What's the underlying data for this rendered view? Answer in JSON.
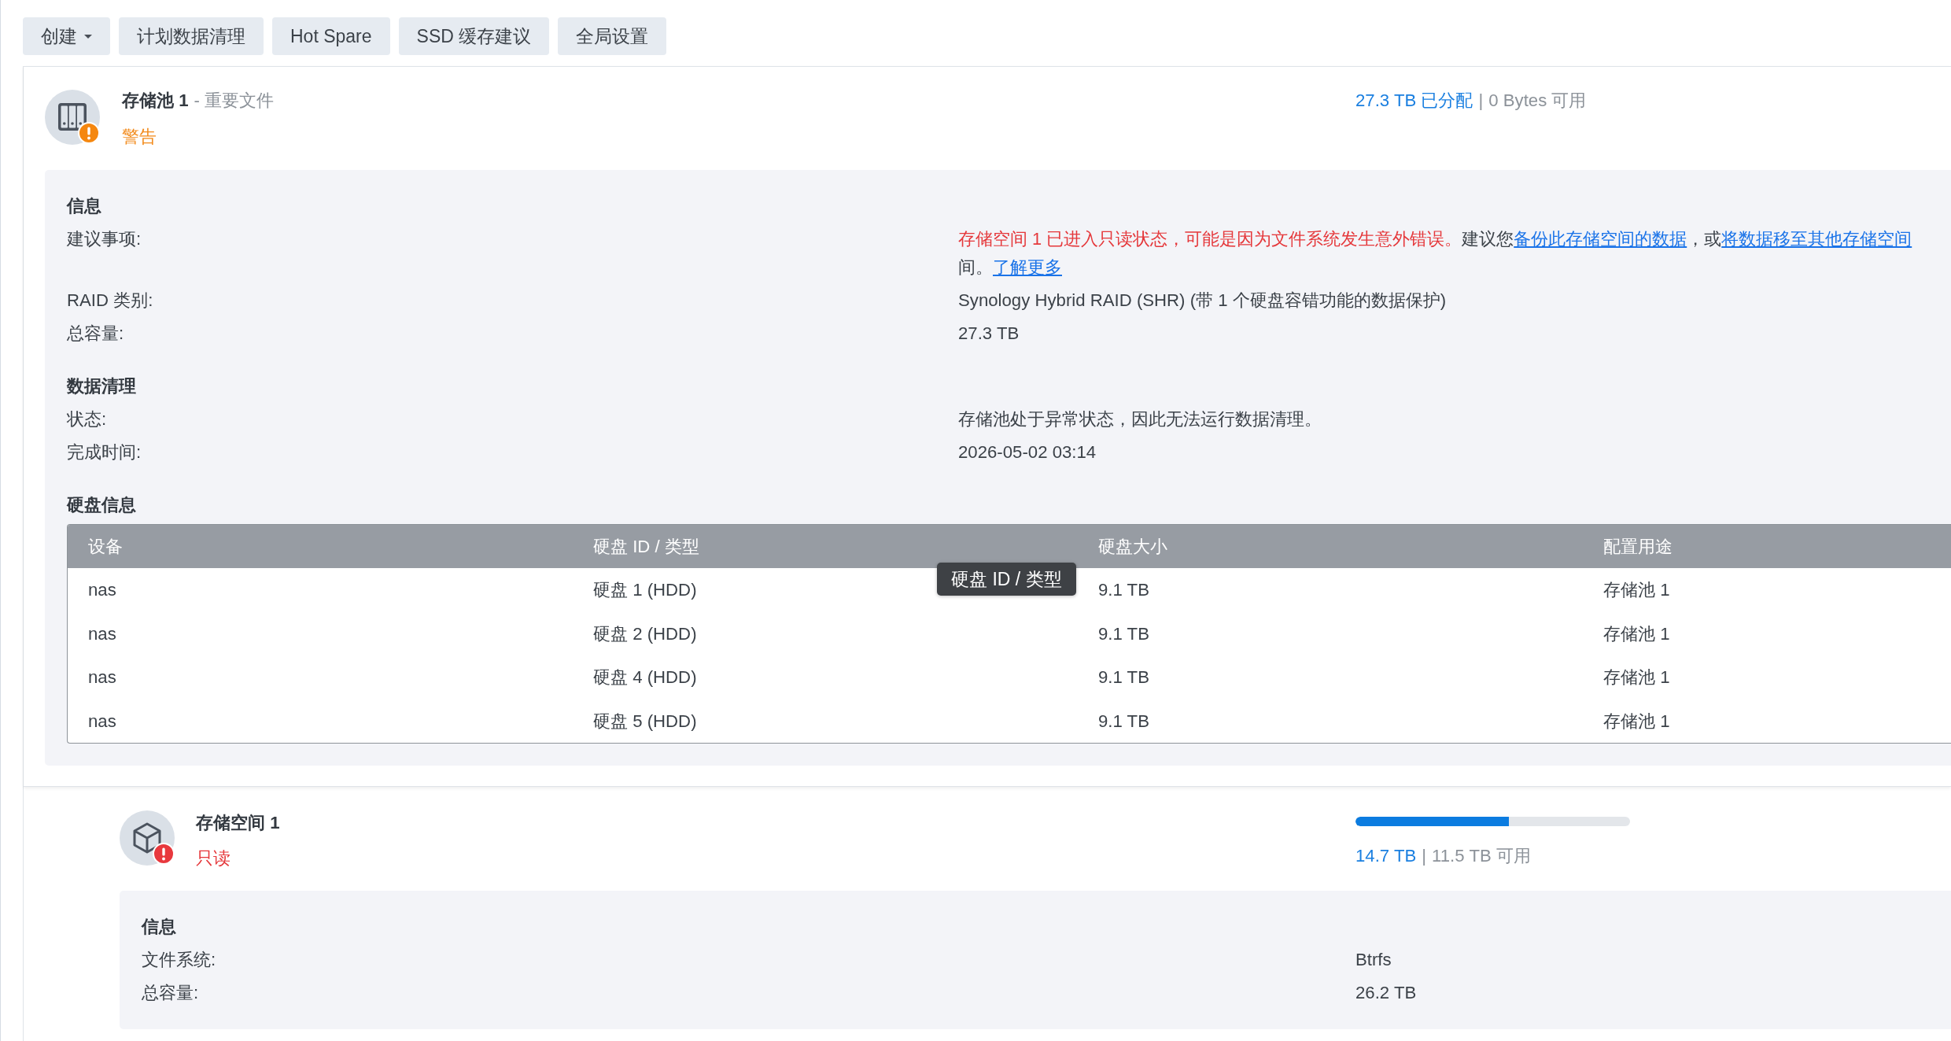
{
  "toolbar": {
    "buttons": [
      {
        "label": "创建",
        "dropdown": true
      },
      {
        "label": "计划数据清理",
        "dropdown": false
      },
      {
        "label": "Hot Spare",
        "dropdown": false
      },
      {
        "label": "SSD 缓存建议",
        "dropdown": false
      },
      {
        "label": "全局设置",
        "dropdown": false
      }
    ]
  },
  "storage_pool": {
    "name": "存储池 1",
    "description": "- 重要文件",
    "status": {
      "text": "警告",
      "kind": "warning"
    },
    "usage": {
      "used": "27.3 TB 已分配",
      "separator": "|",
      "free": "0 Bytes 可用"
    },
    "info": {
      "sections": [
        {
          "heading": "信息",
          "rows": [
            {
              "kind": "paragraph",
              "label": "建议事项:",
              "lines": [
                [
                  {
                    "kind": "error",
                    "text": "存储空间 1 已进入只读状态，可能是因为文件系统发生意外错误。"
                  },
                  {
                    "kind": "text",
                    "text": "建议您"
                  },
                  {
                    "kind": "link",
                    "text": "备份此存储空间的数据"
                  },
                  {
                    "kind": "text",
                    "text": "，或"
                  },
                  {
                    "kind": "link",
                    "text": "将数据移至其他存储空间"
                  }
                ],
                [
                  {
                    "kind": "text",
                    "text": "间。"
                  },
                  {
                    "kind": "link",
                    "text": "了解更多"
                  }
                ]
              ]
            },
            {
              "kind": "text",
              "label": "RAID 类别:",
              "value": "Synology Hybrid RAID (SHR) (带 1 个硬盘容错功能的数据保护)"
            },
            {
              "kind": "text",
              "label": "总容量:",
              "value": "27.3 TB"
            }
          ]
        },
        {
          "heading": "数据清理",
          "rows": [
            {
              "kind": "text",
              "label": "状态:",
              "value": "存储池处于异常状态，因此无法运行数据清理。"
            },
            {
              "kind": "text",
              "label": "完成时间:",
              "value": "2026-05-02 03:14"
            }
          ]
        },
        {
          "heading": "硬盘信息",
          "table": {
            "columns": [
              "设备",
              "硬盘 ID / 类型",
              "硬盘大小",
              "配置用途"
            ],
            "rows": [
              [
                "nas",
                "硬盘 1 (HDD)",
                "9.1 TB",
                "存储池 1"
              ],
              [
                "nas",
                "硬盘 2 (HDD)",
                "9.1 TB",
                "存储池 1"
              ],
              [
                "nas",
                "硬盘 4 (HDD)",
                "9.1 TB",
                "存储池 1"
              ],
              [
                "nas",
                "硬盘 5 (HDD)",
                "9.1 TB",
                "存储池 1"
              ]
            ],
            "tooltip": "硬盘 ID / 类型"
          }
        }
      ]
    }
  },
  "volume": {
    "name": "存储空间 1",
    "status": {
      "text": "只读",
      "kind": "error"
    },
    "usage": {
      "level": 0.56,
      "used": "14.7 TB",
      "separator": "|",
      "free": "11.5 TB 可用"
    },
    "info": {
      "heading": "信息",
      "rows": [
        {
          "label": "文件系统:",
          "value": "Btrfs"
        },
        {
          "label": "总容量:",
          "value": "26.2 TB"
        }
      ]
    }
  }
}
